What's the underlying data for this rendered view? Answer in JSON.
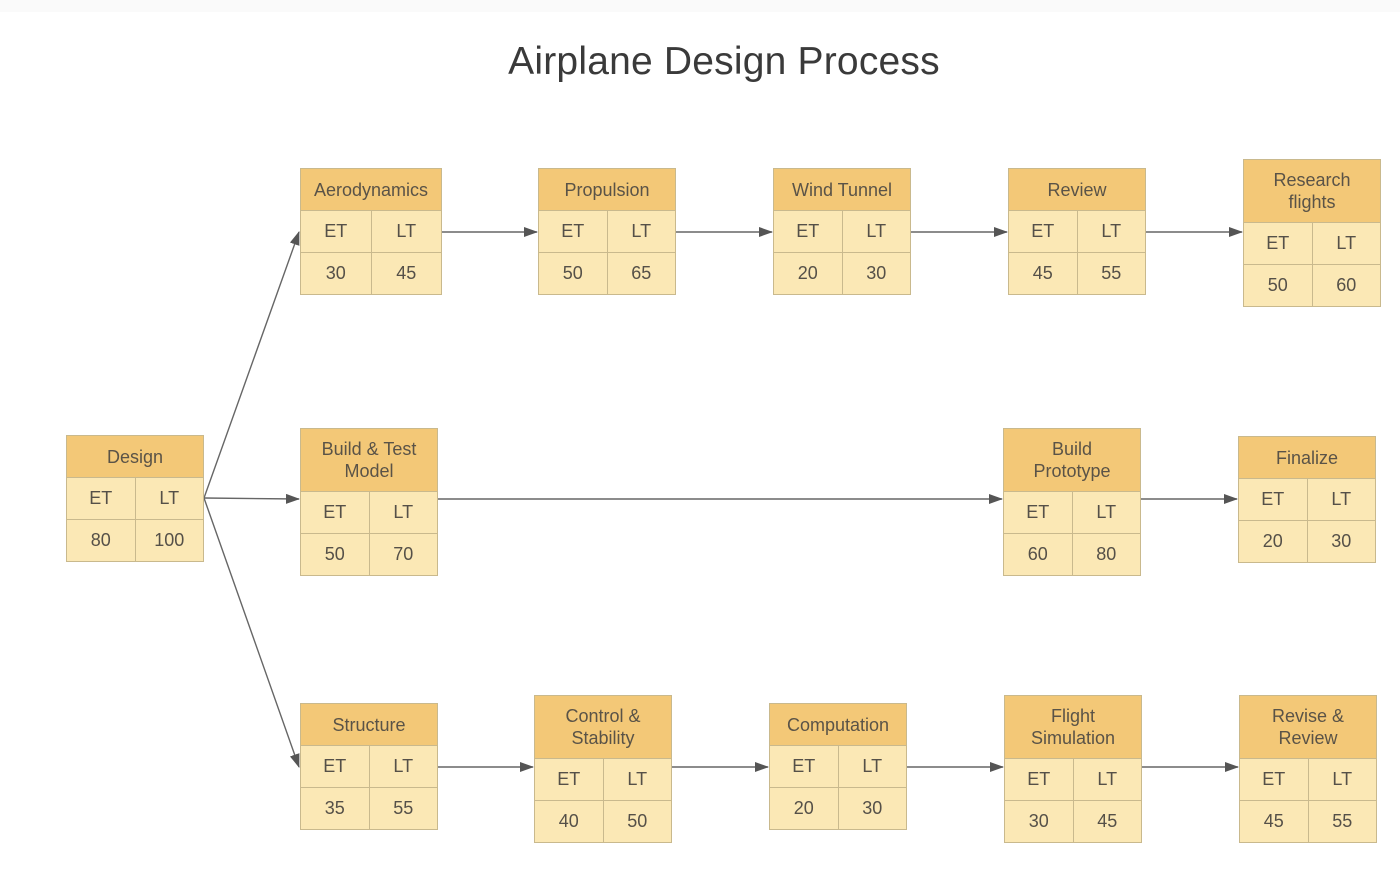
{
  "title": "Airplane Design Process",
  "colors": {
    "header_fill": "#f3c877",
    "body_fill": "#fbe8b5",
    "border": "#c9b98d",
    "arrow": "#555555"
  },
  "labels": {
    "et": "ET",
    "lt": "LT"
  },
  "nodes": {
    "design": {
      "name": "Design",
      "et": "80",
      "lt": "100"
    },
    "aerodynamics": {
      "name": "Aerodynamics",
      "et": "30",
      "lt": "45"
    },
    "propulsion": {
      "name": "Propulsion",
      "et": "50",
      "lt": "65"
    },
    "wind_tunnel": {
      "name": "Wind Tunnel",
      "et": "20",
      "lt": "30"
    },
    "review": {
      "name": "Review",
      "et": "45",
      "lt": "55"
    },
    "research_flights": {
      "name": "Research flights",
      "et": "50",
      "lt": "60"
    },
    "build_test_model": {
      "name": "Build & Test Model",
      "et": "50",
      "lt": "70"
    },
    "build_prototype": {
      "name": "Build Prototype",
      "et": "60",
      "lt": "80"
    },
    "finalize": {
      "name": "Finalize",
      "et": "20",
      "lt": "30"
    },
    "structure": {
      "name": "Structure",
      "et": "35",
      "lt": "55"
    },
    "control_stability": {
      "name": "Control & Stability",
      "et": "40",
      "lt": "50"
    },
    "computation": {
      "name": "Computation",
      "et": "20",
      "lt": "30"
    },
    "flight_simulation": {
      "name": "Flight Simulation",
      "et": "30",
      "lt": "45"
    },
    "revise_review": {
      "name": "Revise & Review",
      "et": "45",
      "lt": "55"
    }
  },
  "edges": [
    {
      "from": "Design",
      "to": "Aerodynamics"
    },
    {
      "from": "Design",
      "to": "Build & Test Model"
    },
    {
      "from": "Design",
      "to": "Structure"
    },
    {
      "from": "Aerodynamics",
      "to": "Propulsion"
    },
    {
      "from": "Propulsion",
      "to": "Wind Tunnel"
    },
    {
      "from": "Wind Tunnel",
      "to": "Review"
    },
    {
      "from": "Review",
      "to": "Research flights"
    },
    {
      "from": "Build & Test Model",
      "to": "Build Prototype"
    },
    {
      "from": "Build Prototype",
      "to": "Finalize"
    },
    {
      "from": "Structure",
      "to": "Control & Stability"
    },
    {
      "from": "Control & Stability",
      "to": "Computation"
    },
    {
      "from": "Computation",
      "to": "Flight Simulation"
    },
    {
      "from": "Flight Simulation",
      "to": "Revise & Review"
    }
  ]
}
